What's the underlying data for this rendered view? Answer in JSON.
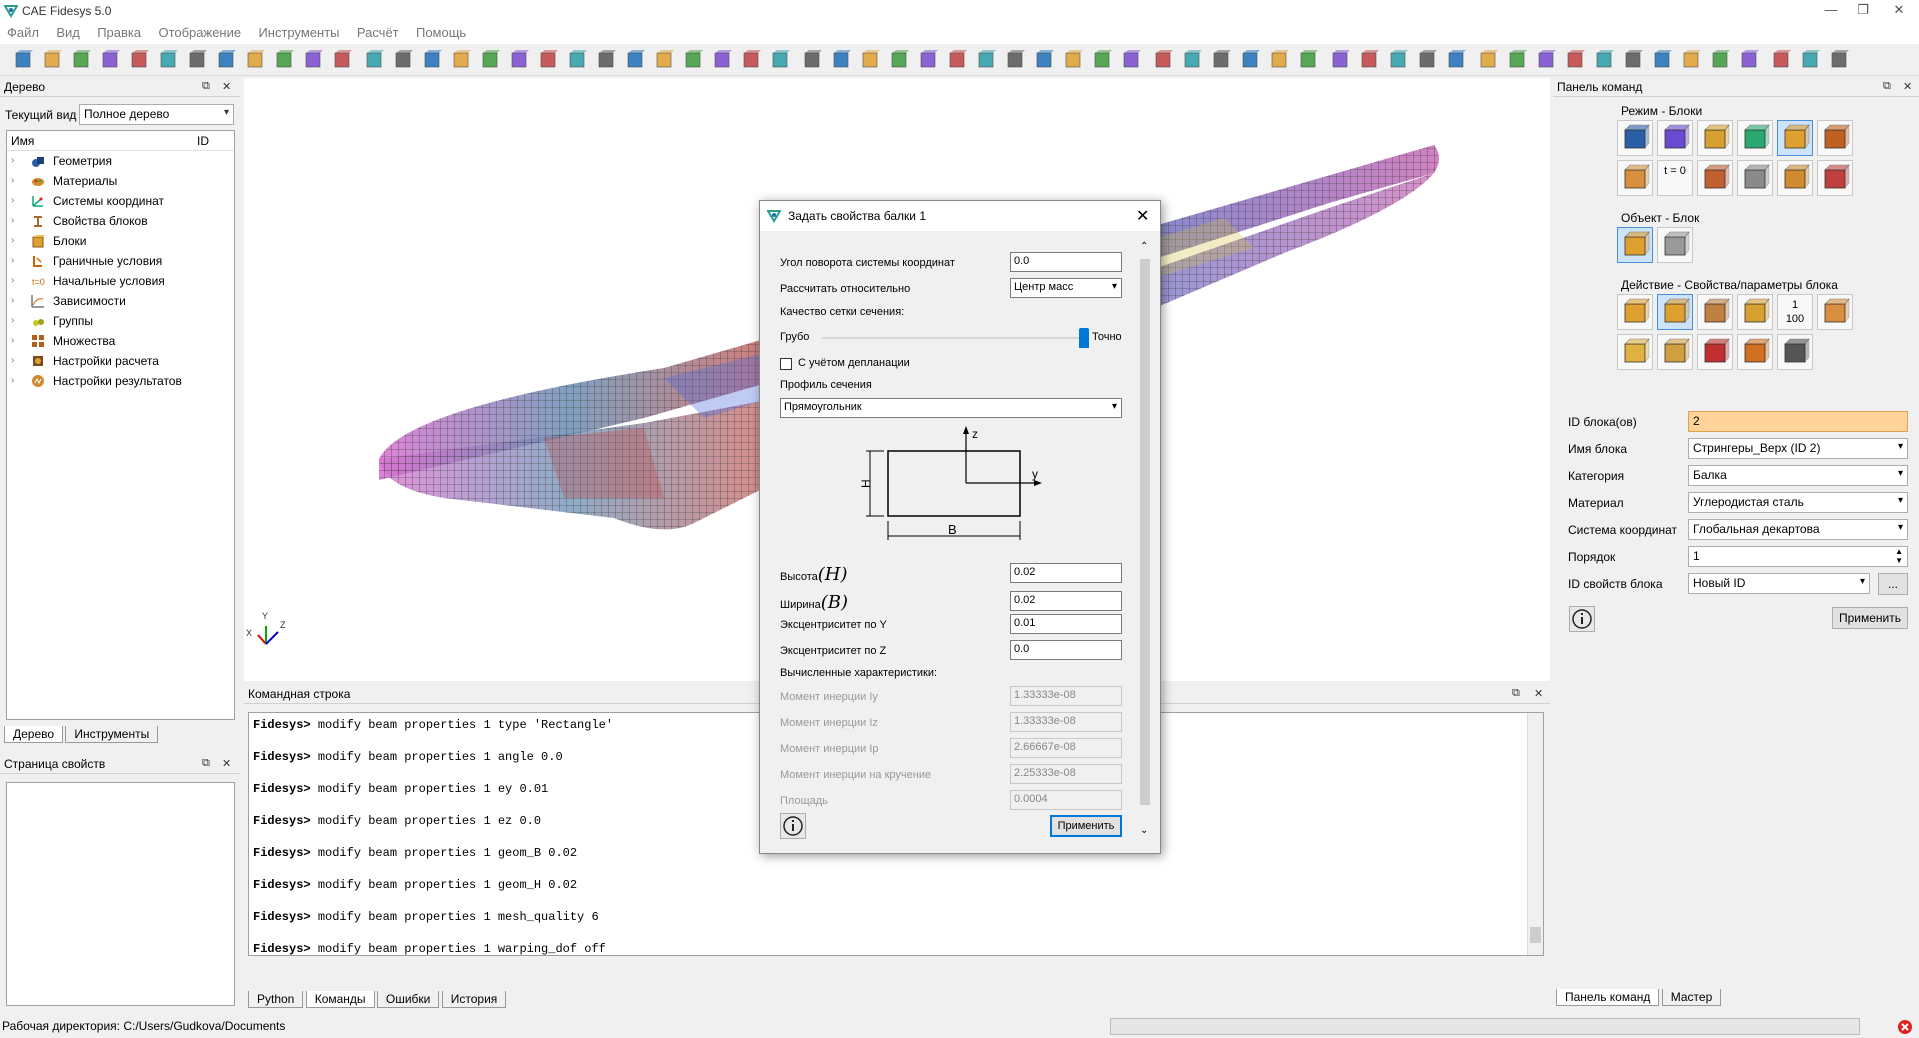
{
  "app": {
    "title": "CAE Fidesys 5.0"
  },
  "menu": [
    "Файл",
    "Вид",
    "Правка",
    "Отображение",
    "Инструменты",
    "Расчёт",
    "Помощь"
  ],
  "tree_panel": {
    "title": "Дерево",
    "current_view_label": "Текущий вид",
    "current_view_value": "Полное дерево",
    "col_name": "Имя",
    "col_id": "ID",
    "items": [
      {
        "label": "Геометрия",
        "icon": "geometry-icon"
      },
      {
        "label": "Материалы",
        "icon": "materials-icon"
      },
      {
        "label": "Системы координат",
        "icon": "coordinate-systems-icon"
      },
      {
        "label": "Свойства блоков",
        "icon": "block-properties-icon"
      },
      {
        "label": "Блоки",
        "icon": "blocks-icon"
      },
      {
        "label": "Граничные условия",
        "icon": "boundary-conditions-icon"
      },
      {
        "label": "Начальные условия",
        "icon": "initial-conditions-icon"
      },
      {
        "label": "Зависимости",
        "icon": "dependencies-icon"
      },
      {
        "label": "Группы",
        "icon": "groups-icon"
      },
      {
        "label": "Множества",
        "icon": "sets-icon"
      },
      {
        "label": "Настройки расчета",
        "icon": "calc-settings-icon"
      },
      {
        "label": "Настройки результатов",
        "icon": "results-settings-icon"
      }
    ],
    "tabs": [
      "Дерево",
      "Инструменты"
    ]
  },
  "props_panel": {
    "title": "Страница свойств"
  },
  "command_line": {
    "title": "Командная строка",
    "prompt": "Fidesys>",
    "lines": [
      "modify beam properties 1 type 'Rectangle'",
      "modify beam properties 1 angle 0.0",
      "modify beam properties 1 ey 0.01",
      "modify beam properties 1 ez 0.0",
      "modify beam properties 1 geom_B 0.02",
      "modify beam properties 1 geom_H 0.02",
      "modify beam properties 1 mesh_quality 6",
      "modify beam properties 1 warping_dof off"
    ],
    "tabs": [
      "Python",
      "Команды",
      "Ошибки",
      "История"
    ]
  },
  "dialog": {
    "title": "Задать свойства балки 1",
    "angle_label": "Угол поворота системы координат",
    "angle_value": "0.0",
    "relative_label": "Рассчитать относительно",
    "relative_value": "Центр масс",
    "mesh_quality_label": "Качество сетки сечения:",
    "mesh_coarse": "Грубо",
    "mesh_fine": "Точно",
    "mesh_quality_level": 1.0,
    "warping_label": "С учётом депланации",
    "warping_checked": false,
    "profile_label": "Профиль сечения",
    "profile_value": "Прямоугольник",
    "diagram": {
      "z": "z",
      "y": "y",
      "h": "H",
      "b": "B"
    },
    "height_label": "Высота",
    "height_sym": "(H)",
    "height_value": "0.02",
    "width_label": "Ширина",
    "width_sym": "(B)",
    "width_value": "0.02",
    "ecc_y_label": "Эксцентриситет по Y",
    "ecc_y_value": "0.01",
    "ecc_z_label": "Эксцентриситет по Z",
    "ecc_z_value": "0.0",
    "computed_label": "Вычисленные характеристики:",
    "iy_label": "Момент инерции Iy",
    "iy_value": "1.33333e-08",
    "iz_label": "Момент инерции Iz",
    "iz_value": "1.33333e-08",
    "ip_label": "Момент инерции Ip",
    "ip_value": "2.66667e-08",
    "it_label": "Момент инерции на кручение",
    "it_value": "2.25333e-08",
    "area_label": "Площадь",
    "area_value": "0.0004",
    "apply": "Применить"
  },
  "right_panel": {
    "title": "Панель команд",
    "mode_title": "Режим - Блоки",
    "object_title": "Объект - Блок",
    "action_title": "Действие - Свойства/параметры блока",
    "t0_label": "t = 0",
    "counter_label": "1\n100",
    "fields": {
      "block_id_label": "ID блока(ов)",
      "block_id_value": "2",
      "block_name_label": "Имя блока",
      "block_name_value": "Стрингеры_Верх (ID 2)",
      "category_label": "Категория",
      "category_value": "Балка",
      "material_label": "Материал",
      "material_value": "Углеродистая сталь",
      "cs_label": "Система координат",
      "cs_value": "Глобальная декартова",
      "order_label": "Порядок",
      "order_value": "1",
      "props_id_label": "ID свойств блока",
      "props_id_value": "Новый ID",
      "more": "...",
      "apply": "Применить"
    },
    "tabs": [
      "Панель команд",
      "Мастер"
    ]
  },
  "axes": {
    "x": "X",
    "y": "Y",
    "z": "Z"
  },
  "status": {
    "workdir": "Рабочая директория: C:/Users/Gudkova/Documents"
  },
  "colors": {
    "accent": "#0078d7",
    "highlight": "#ffd39a"
  }
}
